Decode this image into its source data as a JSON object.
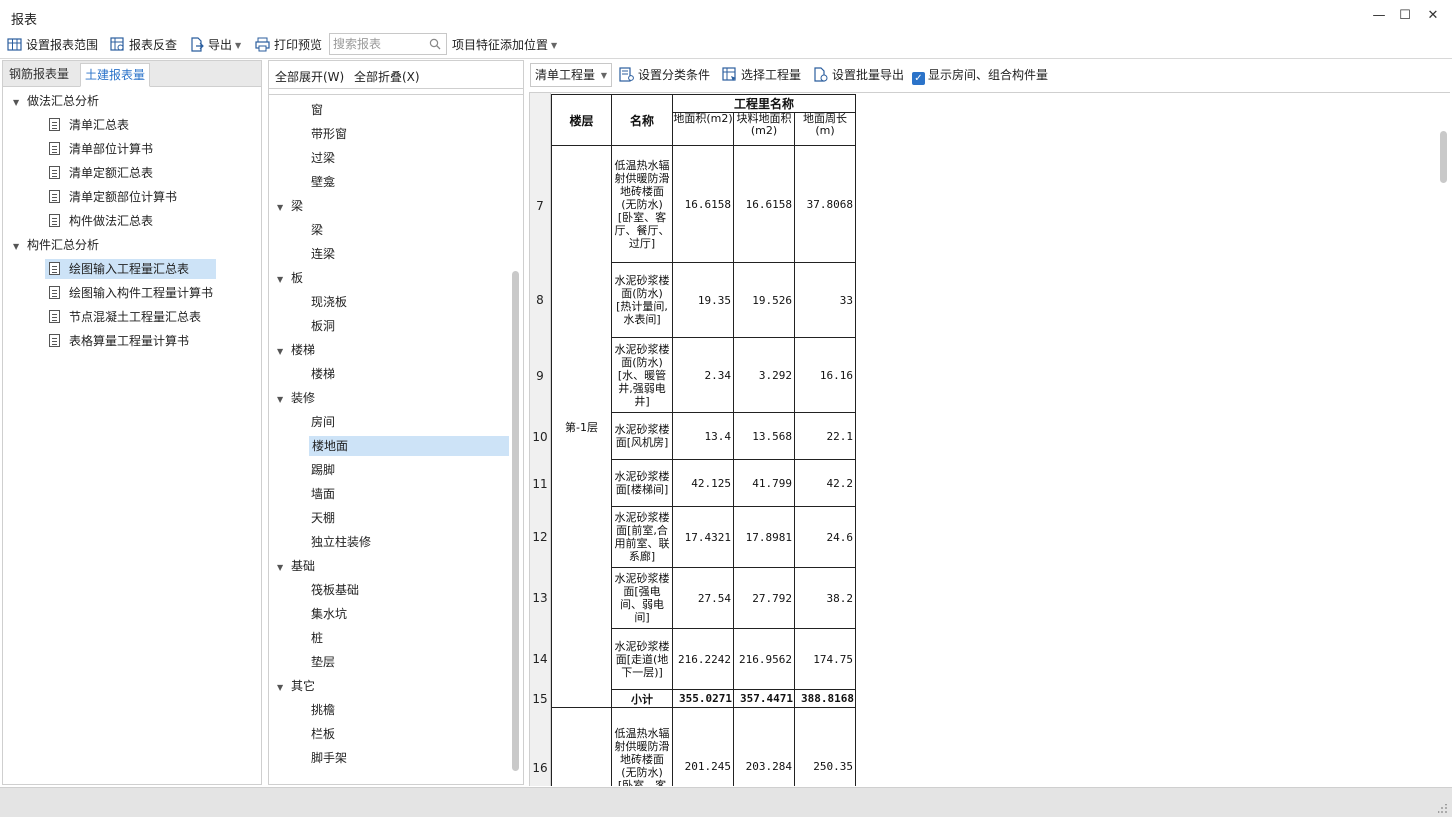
{
  "window": {
    "title": "报表"
  },
  "toolbar": {
    "set_range": "设置报表范围",
    "reverse_check": "报表反查",
    "export": "导出",
    "print_preview": "打印预览",
    "search_placeholder": "搜索报表",
    "feature_position": "项目特征添加位置"
  },
  "left": {
    "tabs": [
      "钢筋报表量",
      "土建报表量"
    ],
    "active_tab": "土建报表量",
    "groups": [
      {
        "label": "做法汇总分析",
        "items": [
          "清单汇总表",
          "清单部位计算书",
          "清单定额汇总表",
          "清单定额部位计算书",
          "构件做法汇总表"
        ]
      },
      {
        "label": "构件汇总分析",
        "items": [
          "绘图输入工程量汇总表",
          "绘图输入构件工程量计算书",
          "节点混凝土工程量汇总表",
          "表格算量工程量计算书"
        ]
      }
    ],
    "selected_item": "绘图输入工程量汇总表"
  },
  "middle": {
    "expand_all": "全部展开(W)",
    "collapse_all": "全部折叠(X)",
    "rows": [
      {
        "label": "窗",
        "level": 1
      },
      {
        "label": "带形窗",
        "level": 1
      },
      {
        "label": "过梁",
        "level": 1
      },
      {
        "label": "壁龛",
        "level": 1
      },
      {
        "label": "梁",
        "level": 0
      },
      {
        "label": "梁",
        "level": 1
      },
      {
        "label": "连梁",
        "level": 1
      },
      {
        "label": "板",
        "level": 0
      },
      {
        "label": "现浇板",
        "level": 1
      },
      {
        "label": "板洞",
        "level": 1
      },
      {
        "label": "楼梯",
        "level": 0
      },
      {
        "label": "楼梯",
        "level": 1
      },
      {
        "label": "装修",
        "level": 0
      },
      {
        "label": "房间",
        "level": 1
      },
      {
        "label": "楼地面",
        "level": 1
      },
      {
        "label": "踢脚",
        "level": 1
      },
      {
        "label": "墙面",
        "level": 1
      },
      {
        "label": "天棚",
        "level": 1
      },
      {
        "label": "独立柱装修",
        "level": 1
      },
      {
        "label": "基础",
        "level": 0
      },
      {
        "label": "筏板基础",
        "level": 1
      },
      {
        "label": "集水坑",
        "level": 1
      },
      {
        "label": "桩",
        "level": 1
      },
      {
        "label": "垫层",
        "level": 1
      },
      {
        "label": "其它",
        "level": 0
      },
      {
        "label": "挑檐",
        "level": 1
      },
      {
        "label": "栏板",
        "level": 1
      },
      {
        "label": "脚手架",
        "level": 1
      }
    ],
    "selected_index": 14
  },
  "right_toolbar": {
    "combo_value": "清单工程量",
    "set_category": "设置分类条件",
    "select_quantity": "选择工程量",
    "batch_export": "设置批量导出",
    "show_rooms": "显示房间、组合构件量",
    "show_rooms_checked": true
  },
  "report": {
    "headers": {
      "floor": "楼层",
      "name": "名称",
      "group": "工程里名称",
      "cols": [
        "地面积(m2)",
        "块料地面积(m2)",
        "地面周长(m)"
      ]
    },
    "header_row_nums": [
      "",
      "",
      "",
      "",
      "",
      ""
    ],
    "floor_label": "第-1层",
    "rows": [
      {
        "n": "7",
        "name": "低温热水辐射供暖防滑地砖楼面(无防水)[卧室、客厅、餐厅、过厅]",
        "v": [
          "16.6158",
          "16.6158",
          "37.8068"
        ]
      },
      {
        "n": "8",
        "name": "水泥砂浆楼面(防水)[热计量间,水表间]",
        "v": [
          "19.35",
          "19.526",
          "33"
        ]
      },
      {
        "n": "9",
        "name": "水泥砂浆楼面(防水)[水、暖管井,强弱电井]",
        "v": [
          "2.34",
          "3.292",
          "16.16"
        ]
      },
      {
        "n": "10",
        "name": "水泥砂浆楼面[风机房]",
        "v": [
          "13.4",
          "13.568",
          "22.1"
        ]
      },
      {
        "n": "11",
        "name": "水泥砂浆楼面[楼梯间]",
        "v": [
          "42.125",
          "41.799",
          "42.2"
        ]
      },
      {
        "n": "12",
        "name": "水泥砂浆楼面[前室,合用前室、联系廊]",
        "v": [
          "17.4321",
          "17.8981",
          "24.6"
        ]
      },
      {
        "n": "13",
        "name": "水泥砂浆楼面[强电间、弱电间]",
        "v": [
          "27.54",
          "27.792",
          "38.2"
        ]
      },
      {
        "n": "14",
        "name": "水泥砂浆楼面[走道(地下一层)]",
        "v": [
          "216.2242",
          "216.9562",
          "174.75"
        ]
      }
    ],
    "subtotal": {
      "n": "15",
      "label": "小计",
      "v": [
        "355.0271",
        "357.4471",
        "388.8168"
      ]
    },
    "next_row": {
      "n": "16",
      "name": "低温热水辐射供暖防滑地砖楼面(无防水)[卧室、客厅",
      "v": [
        "201.245",
        "203.284",
        "250.35"
      ]
    }
  }
}
